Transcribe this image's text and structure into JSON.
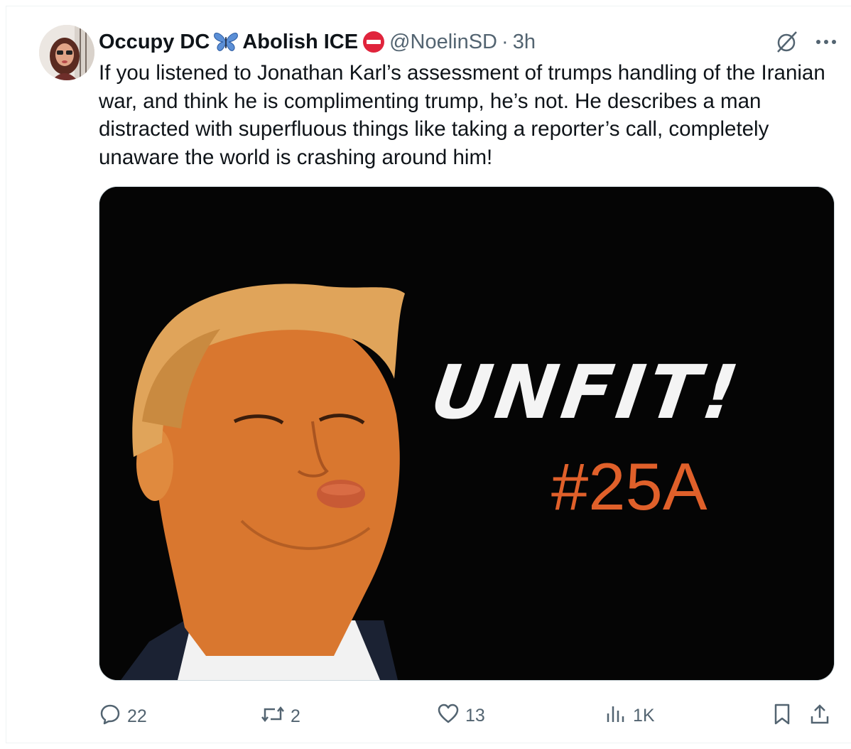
{
  "tweet": {
    "display_name": "Occupy DC",
    "display_name_suffix": "Abolish ICE",
    "handle": "@NoelinSD",
    "separator": "·",
    "time": "3h",
    "text": "If you listened to Jonathan Karl’s assessment of trumps handling of the Iranian war, and think he is complimenting trump, he’s not. He describes a man distracted with superfluous things like taking a reporter’s call, completely unaware the world is crashing around him!",
    "media": {
      "headline": "UNFIT!",
      "hashtag": "#25A"
    },
    "stats": {
      "replies": "22",
      "reposts": "2",
      "likes": "13",
      "views": "1K"
    }
  },
  "icons": {
    "header": [
      "butterfly-icon",
      "no-entry-icon",
      "grok-icon",
      "more-icon"
    ],
    "actions": [
      "reply-icon",
      "repost-icon",
      "like-icon",
      "views-icon",
      "bookmark-icon",
      "share-icon"
    ]
  },
  "colors": {
    "text_primary": "#0f1419",
    "text_secondary": "#536471",
    "butterfly": "#5b8fd6",
    "no_entry": "#e0243c",
    "hashtag": "#e0602a",
    "media_bg": "#050505"
  }
}
